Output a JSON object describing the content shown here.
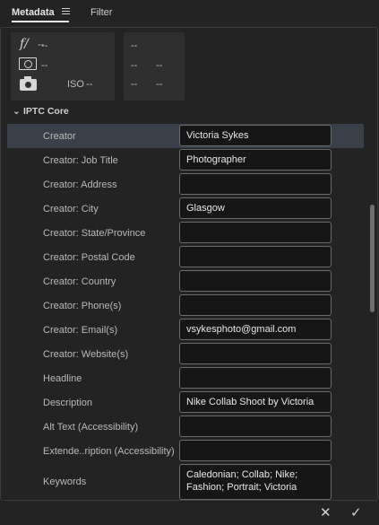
{
  "tabs": {
    "metadata": "Metadata",
    "filter": "Filter"
  },
  "exif": {
    "fnumber_icon": "f/",
    "fnumber_value": "--",
    "exposure_value": "--",
    "iso_label": "ISO",
    "iso_value": "--",
    "right_col": [
      "--",
      "--",
      "--",
      "--",
      "--"
    ]
  },
  "section": {
    "title": "IPTC Core"
  },
  "fields": [
    {
      "label": "Creator",
      "value": "Victoria Sykes",
      "selected": true
    },
    {
      "label": "Creator: Job Title",
      "value": "Photographer"
    },
    {
      "label": "Creator: Address",
      "value": ""
    },
    {
      "label": "Creator: City",
      "value": "Glasgow"
    },
    {
      "label": "Creator: State/Province",
      "value": ""
    },
    {
      "label": "Creator: Postal Code",
      "value": ""
    },
    {
      "label": "Creator: Country",
      "value": ""
    },
    {
      "label": "Creator: Phone(s)",
      "value": ""
    },
    {
      "label": "Creator: Email(s)",
      "value": "vsykesphoto@gmail.com"
    },
    {
      "label": "Creator: Website(s)",
      "value": ""
    },
    {
      "label": "Headline",
      "value": ""
    },
    {
      "label": "Description",
      "value": "Nike Collab Shoot by Victoria"
    },
    {
      "label": "Alt Text (Accessibility)",
      "value": ""
    },
    {
      "label": "Extende..ription (Accessibility)",
      "value": ""
    },
    {
      "label": "Keywords",
      "value": "Caledonian; Collab; Nike; Fashion; Portrait; Victoria",
      "tall": true
    }
  ],
  "footer": {
    "cancel": "✕",
    "confirm": "✓"
  }
}
